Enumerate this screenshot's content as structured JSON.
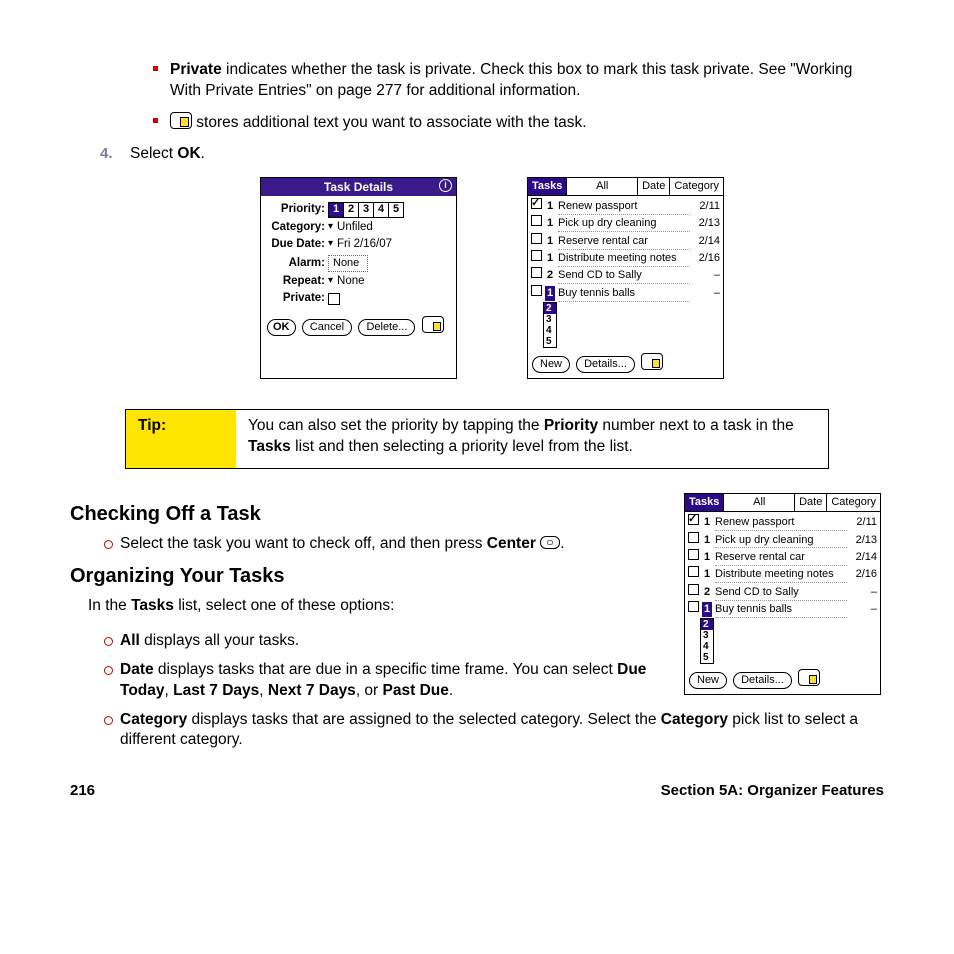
{
  "intro": {
    "private_bold": "Private",
    "private_text": " indicates whether the task is private. Check this box to mark this task private. See \"Working With Private Entries\" on page 277 for additional information.",
    "note_text": " stores additional text you want to associate with the task."
  },
  "step4": {
    "num": "4.",
    "pre": "Select ",
    "ok": "OK",
    "post": "."
  },
  "task_details": {
    "title": "Task Details",
    "rows": {
      "priority_label": "Priority:",
      "priority_options": [
        "1",
        "2",
        "3",
        "4",
        "5"
      ],
      "priority_selected": "1",
      "category_label": "Category:",
      "category_value": "Unfiled",
      "due_label": "Due Date:",
      "due_value": "Fri 2/16/07",
      "alarm_label": "Alarm:",
      "alarm_value": "None",
      "repeat_label": "Repeat:",
      "repeat_value": "None",
      "private_label": "Private:"
    },
    "buttons": {
      "ok": "OK",
      "cancel": "Cancel",
      "delete": "Delete..."
    }
  },
  "tasks_app": {
    "tabs": [
      "Tasks",
      "All",
      "Date",
      "Category"
    ],
    "active_tab": "Tasks",
    "items": [
      {
        "checked": true,
        "pri": "1",
        "desc": "Renew passport",
        "date": "2/11"
      },
      {
        "checked": false,
        "pri": "1",
        "desc": "Pick up dry cleaning",
        "date": "2/13"
      },
      {
        "checked": false,
        "pri": "1",
        "desc": "Reserve rental car",
        "date": "2/14"
      },
      {
        "checked": false,
        "pri": "1",
        "desc": "Distribute meeting notes",
        "date": "2/16"
      },
      {
        "checked": false,
        "pri": "2",
        "desc": "Send CD to Sally",
        "date": "–"
      },
      {
        "checked": false,
        "pri": "1",
        "desc": "Buy tennis balls",
        "date": "–",
        "editing": true
      }
    ],
    "priority_dropdown": [
      "2",
      "3",
      "4",
      "5"
    ],
    "buttons": {
      "new": "New",
      "details": "Details..."
    }
  },
  "tip": {
    "label": "Tip:",
    "text_a": "You can also set the priority by tapping the ",
    "b1": "Priority",
    "text_b": " number next to a task in the ",
    "b2": "Tasks",
    "text_c": " list and then selecting a priority level from the list."
  },
  "checking": {
    "heading": "Checking Off a Task",
    "line_a": "Select the task you want to check off, and then press ",
    "center": "Center",
    "period": "."
  },
  "organizing": {
    "heading": "Organizing Your Tasks",
    "intro_a": "In the ",
    "intro_b": "Tasks",
    "intro_c": " list, select one of these options:",
    "opt_all_b": "All",
    "opt_all_t": " displays all your tasks.",
    "opt_date_b": "Date",
    "opt_date_t1": " displays tasks that are due in a specific time frame. You can select ",
    "d1": "Due Today",
    "c1": ", ",
    "d2": "Last 7 Days",
    "c2": ", ",
    "d3": "Next 7 Days",
    "c3": ", or ",
    "d4": "Past Due",
    "c4": ".",
    "opt_cat_b": "Category",
    "opt_cat_t1": " displays tasks that are assigned to the selected category. Select the ",
    "opt_cat_b2": "Category",
    "opt_cat_t2": " pick list to select a different category."
  },
  "footer": {
    "page": "216",
    "section": "Section 5A: Organizer Features"
  }
}
